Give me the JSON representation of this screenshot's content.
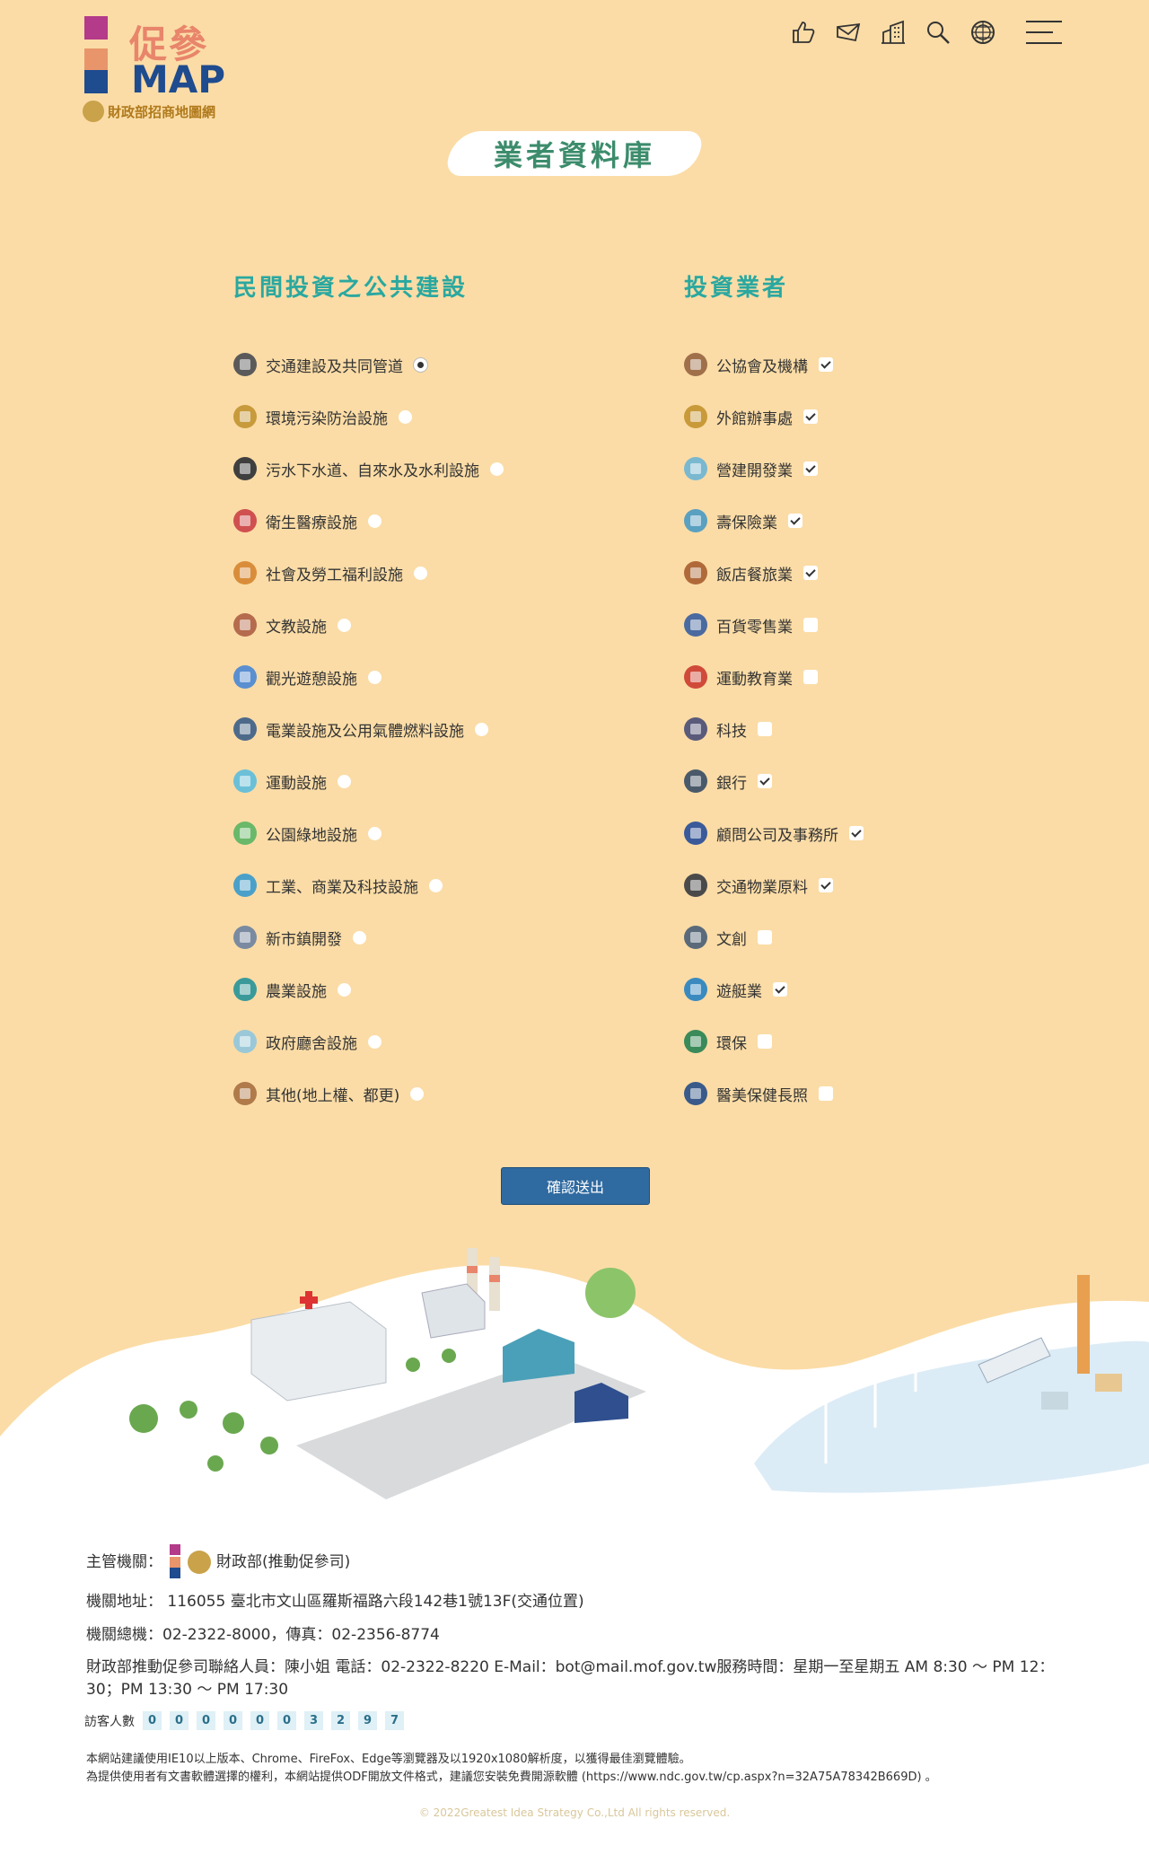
{
  "brand": {
    "title_cjk": "促參",
    "title_map": "MAP",
    "subtitle": "財政部招商地圖網"
  },
  "header_icons": [
    "thumbs-up-icon",
    "mail-icon",
    "building-icon",
    "search-icon",
    "globe-icon",
    "menu-icon"
  ],
  "page_title": "業者資料庫",
  "left": {
    "heading": "民間投資之公共建設",
    "items": [
      {
        "label": "交通建設及共同管道",
        "checked": true,
        "color": "#5a5a5a"
      },
      {
        "label": "環境污染防治設施",
        "checked": false,
        "color": "#c79a3c"
      },
      {
        "label": "污水下水道、自來水及水利設施",
        "checked": false,
        "color": "#3f3f3f"
      },
      {
        "label": "衛生醫療設施",
        "checked": false,
        "color": "#d05050"
      },
      {
        "label": "社會及勞工福利設施",
        "checked": false,
        "color": "#d98d3a"
      },
      {
        "label": "文教設施",
        "checked": false,
        "color": "#b56b4d"
      },
      {
        "label": "觀光遊憩設施",
        "checked": false,
        "color": "#5a8fd0"
      },
      {
        "label": "電業設施及公用氣體燃料設施",
        "checked": false,
        "color": "#4e6a8a"
      },
      {
        "label": "運動設施",
        "checked": false,
        "color": "#6bc0d8"
      },
      {
        "label": "公園綠地設施",
        "checked": false,
        "color": "#6ab86a"
      },
      {
        "label": "工業、商業及科技設施",
        "checked": false,
        "color": "#4aa0c8"
      },
      {
        "label": "新市鎮開發",
        "checked": false,
        "color": "#7a8aa0"
      },
      {
        "label": "農業設施",
        "checked": false,
        "color": "#3a9a9a"
      },
      {
        "label": "政府廳舍設施",
        "checked": false,
        "color": "#9ac8d8"
      },
      {
        "label": "其他(地上權、都更)",
        "checked": false,
        "color": "#b07a4a"
      }
    ]
  },
  "right": {
    "heading": "投資業者",
    "items": [
      {
        "label": "公協會及機構",
        "checked": true,
        "color": "#a0704a"
      },
      {
        "label": "外館辦事處",
        "checked": true,
        "color": "#c99a3a"
      },
      {
        "label": "營建開發業",
        "checked": true,
        "color": "#7ab8d0"
      },
      {
        "label": "壽保險業",
        "checked": true,
        "color": "#5aa0c0"
      },
      {
        "label": "飯店餐旅業",
        "checked": true,
        "color": "#b06a3a"
      },
      {
        "label": "百貨零售業",
        "checked": false,
        "color": "#4a6aa0"
      },
      {
        "label": "運動教育業",
        "checked": false,
        "color": "#d04a3a"
      },
      {
        "label": "科技",
        "checked": false,
        "color": "#5a5a7a"
      },
      {
        "label": "銀行",
        "checked": true,
        "color": "#4a5a6a"
      },
      {
        "label": "顧問公司及事務所",
        "checked": true,
        "color": "#3a5a9a"
      },
      {
        "label": "交通物業原料",
        "checked": true,
        "color": "#4a4a4a"
      },
      {
        "label": "文創",
        "checked": false,
        "color": "#5a6a7a"
      },
      {
        "label": "遊艇業",
        "checked": true,
        "color": "#3a8ac0"
      },
      {
        "label": "環保",
        "checked": false,
        "color": "#3a8a5a"
      },
      {
        "label": "醫美保健長照",
        "checked": false,
        "color": "#3a5a8a"
      }
    ]
  },
  "submit_label": "確認送出",
  "footer": {
    "agency_label": "主管機關：",
    "agency_name": "財政部(推動促參司)",
    "address": "機關地址： 116055 臺北市文山區羅斯福路六段142巷1號13F(交通位置)",
    "phone": "機關總機：02-2322-8000，傳真：02-2356-8774",
    "contact": "財政部推動促參司聯絡人員：陳小姐 電話：02-2322-8220 E-Mail：bot@mail.mof.gov.tw服務時間：星期一至星期五 AM 8:30 ～ PM 12：30；PM 13:30 ～ PM 17:30",
    "visitor_label": "訪客人數",
    "visitor_digits": [
      "0",
      "0",
      "0",
      "0",
      "0",
      "0",
      "3",
      "2",
      "9",
      "7"
    ],
    "note1": "本網站建議使用IE10以上版本、Chrome、FireFox、Edge等瀏覽器及以1920x1080解析度，以獲得最佳瀏覽體驗。",
    "note2": "為提供使用者有文書軟體選擇的權利，本網站提供ODF開放文件格式，建議您安裝免費開源軟體 (https://www.ndc.gov.tw/cp.aspx?n=32A75A78342B669D) 。",
    "copyright": "© 2022Greatest Idea Strategy Co.,Ltd All rights reserved."
  }
}
